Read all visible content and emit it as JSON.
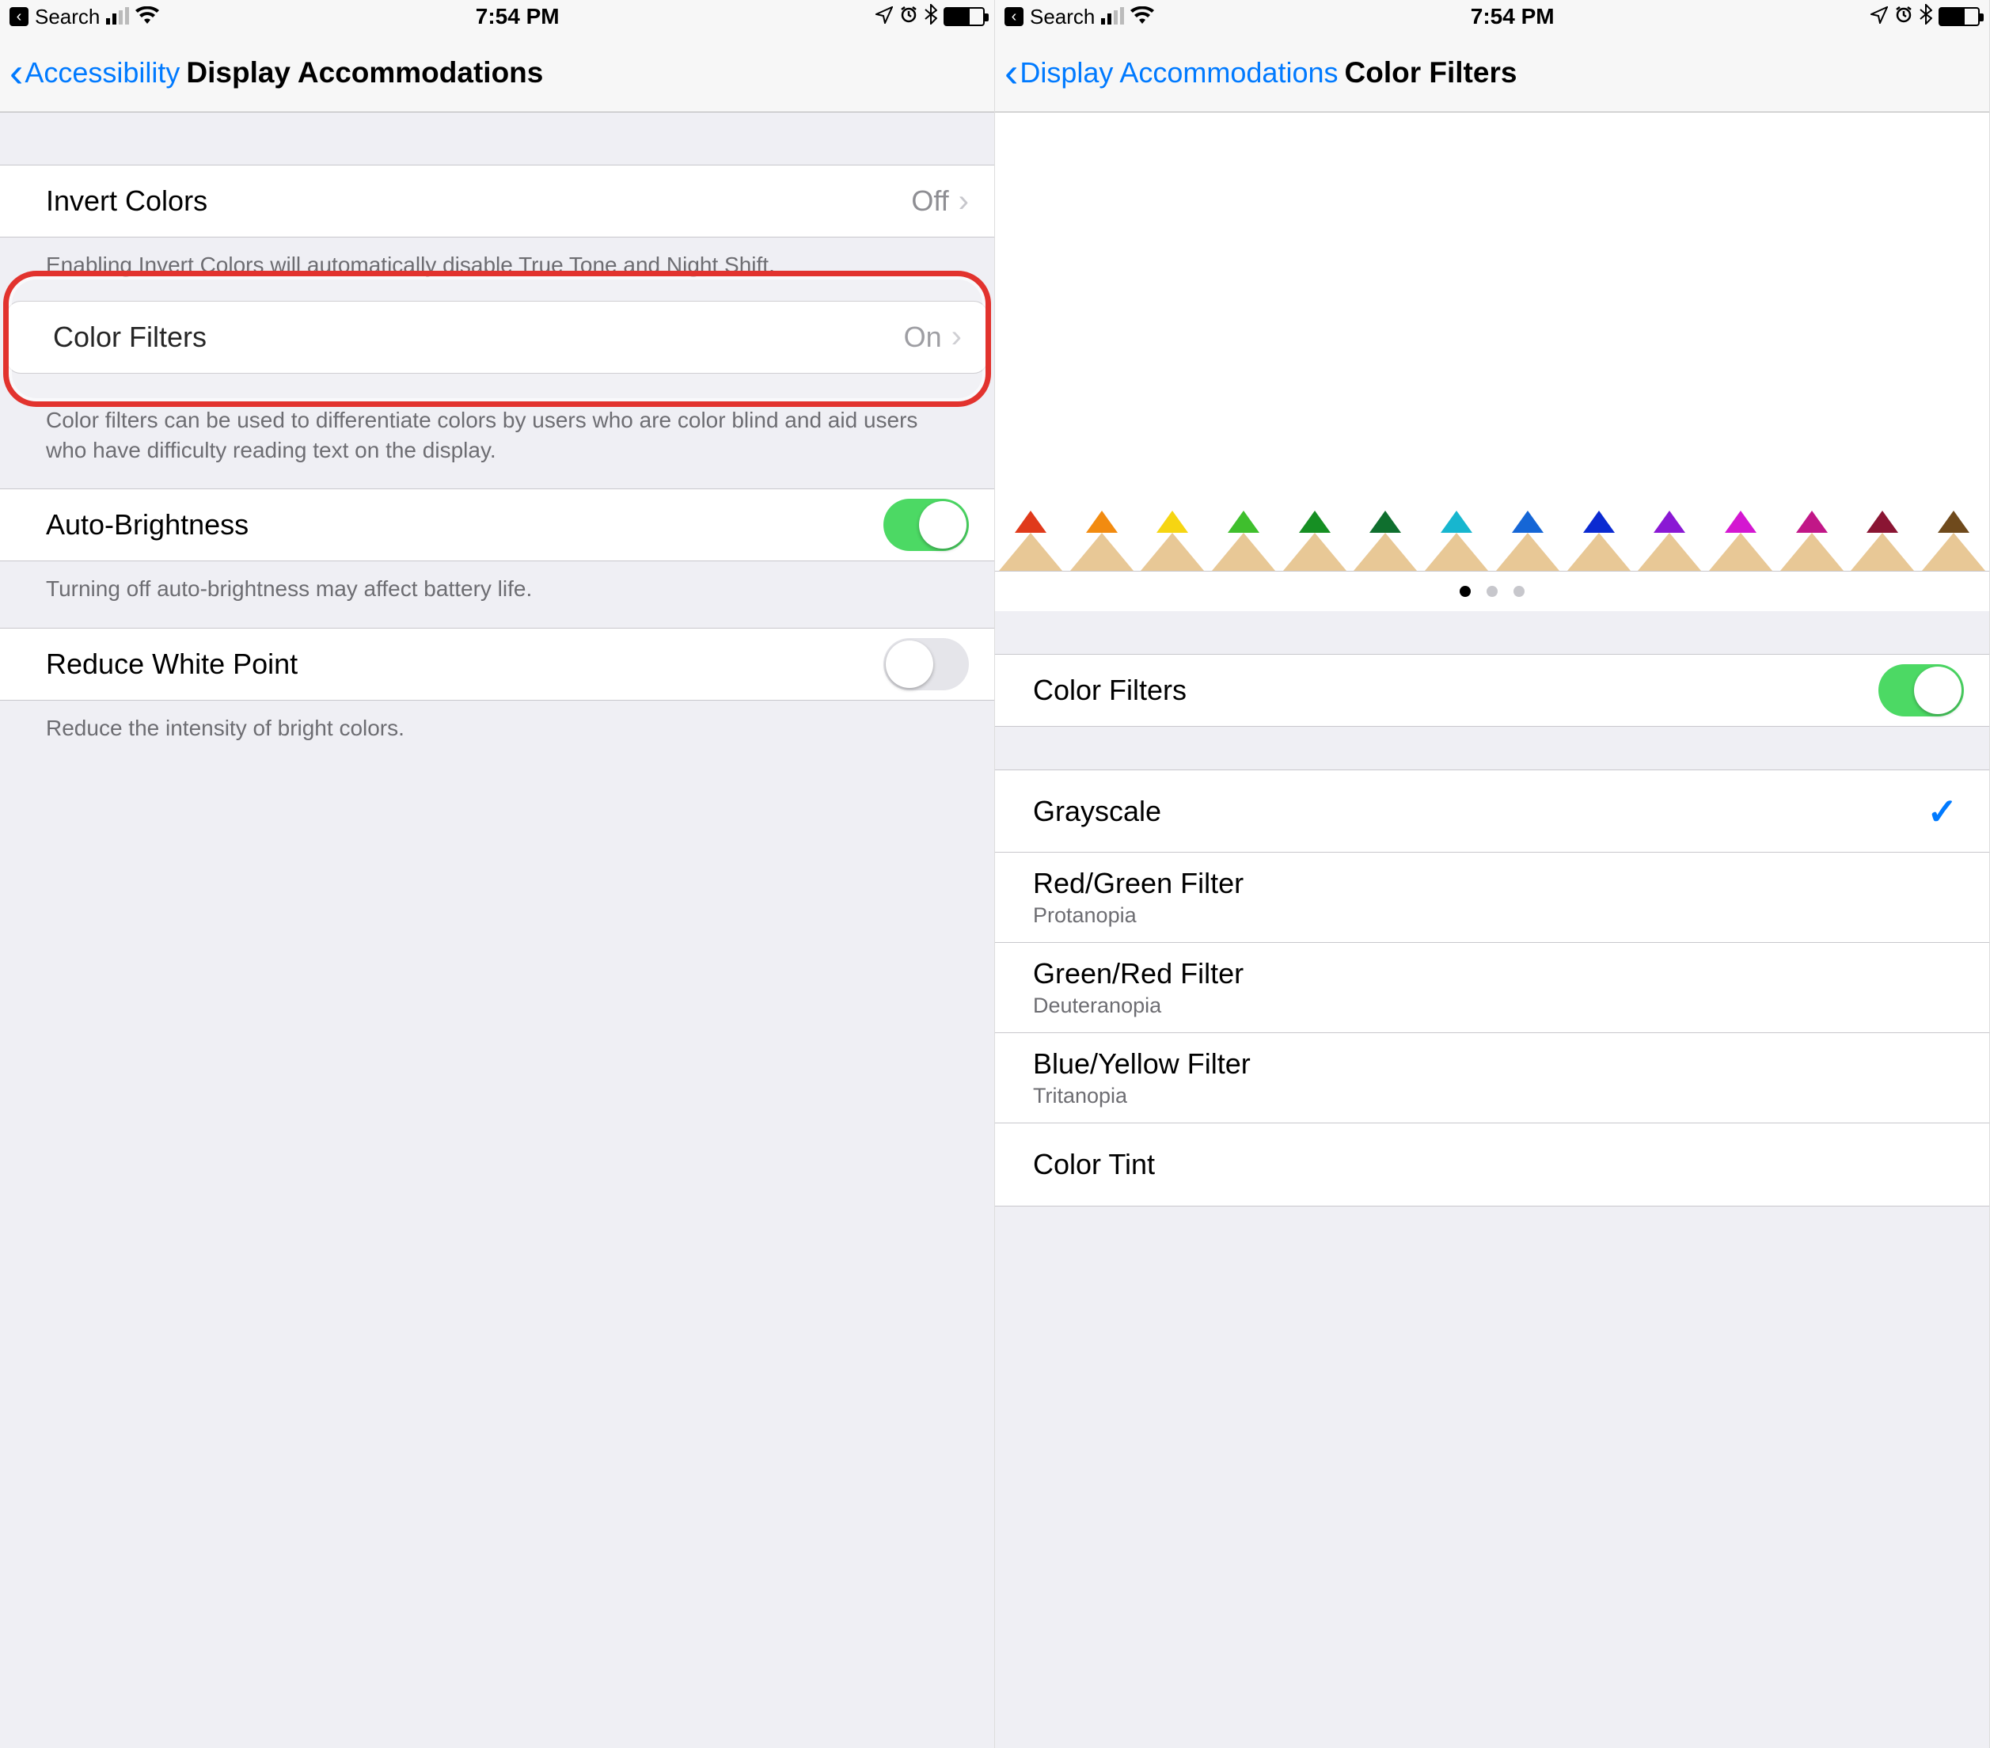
{
  "status": {
    "back_label": "Search",
    "time": "7:54 PM",
    "battery_pct": 65
  },
  "left": {
    "nav_back": "Accessibility",
    "nav_title": "Display Accommodations",
    "invert": {
      "label": "Invert Colors",
      "value": "Off"
    },
    "invert_footer": "Enabling Invert Colors will automatically disable True Tone and Night Shift.",
    "color_filters": {
      "label": "Color Filters",
      "value": "On"
    },
    "color_filters_footer": "Color filters can be used to differentiate colors by users who are color blind and aid users who have difficulty reading text on the display.",
    "auto_brightness": {
      "label": "Auto-Brightness",
      "on": true
    },
    "auto_brightness_footer": "Turning off auto-brightness may affect battery life.",
    "reduce_white": {
      "label": "Reduce White Point",
      "on": false
    },
    "reduce_white_footer": "Reduce the intensity of bright colors."
  },
  "right": {
    "nav_back": "Display Accommodations",
    "nav_title": "Color Filters",
    "toggle": {
      "label": "Color Filters",
      "on": true
    },
    "pencil_colors": [
      "#e03a1b",
      "#f28b10",
      "#f6d512",
      "#3fbf2d",
      "#168f23",
      "#0f6f2e",
      "#17b6cf",
      "#1566d6",
      "#0b2ad1",
      "#8a18d4",
      "#d417d1",
      "#c11787",
      "#8a1533",
      "#6f4a1c"
    ],
    "filters": [
      {
        "label": "Grayscale",
        "sub": "",
        "selected": true
      },
      {
        "label": "Red/Green Filter",
        "sub": "Protanopia",
        "selected": false
      },
      {
        "label": "Green/Red Filter",
        "sub": "Deuteranopia",
        "selected": false
      },
      {
        "label": "Blue/Yellow Filter",
        "sub": "Tritanopia",
        "selected": false
      },
      {
        "label": "Color Tint",
        "sub": "",
        "selected": false
      }
    ],
    "pager": {
      "count": 3,
      "active": 0
    }
  }
}
